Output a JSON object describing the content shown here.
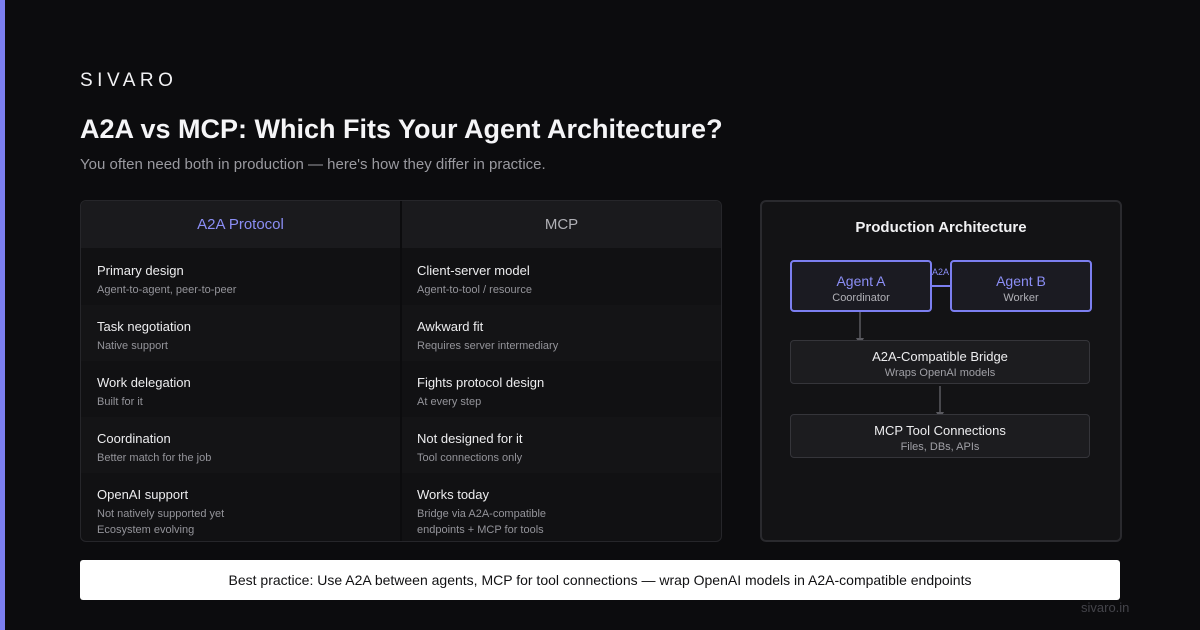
{
  "brand": "SIVARO",
  "title": "A2A vs MCP: Which Fits Your Agent Architecture?",
  "subtitle": "You often need both in production — here's how they differ in practice.",
  "comparison": {
    "left_header": "A2A Protocol",
    "right_header": "MCP",
    "rows": [
      {
        "left_title": "Primary design",
        "left_desc": "Agent-to-agent, peer-to-peer",
        "right_title": "Client-server model",
        "right_desc": "Agent-to-tool / resource"
      },
      {
        "left_title": "Task negotiation",
        "left_desc": "Native support",
        "right_title": "Awkward fit",
        "right_desc": "Requires server intermediary"
      },
      {
        "left_title": "Work delegation",
        "left_desc": "Built for it",
        "right_title": "Fights protocol design",
        "right_desc": "At every step"
      },
      {
        "left_title": "Coordination",
        "left_desc": "Better match for the job",
        "right_title": "Not designed for it",
        "right_desc": "Tool connections only"
      },
      {
        "left_title": "OpenAI support",
        "left_desc": "Not natively supported yet",
        "left_desc2": "Ecosystem evolving",
        "right_title": "Works today",
        "right_desc": "Bridge via A2A-compatible",
        "right_desc2": "endpoints + MCP for tools"
      }
    ]
  },
  "architecture": {
    "title": "Production Architecture",
    "agent_a": {
      "name": "Agent A",
      "role": "Coordinator"
    },
    "agent_b": {
      "name": "Agent B",
      "role": "Worker"
    },
    "link_label": "A2A",
    "bridge": {
      "name": "A2A-Compatible Bridge",
      "desc": "Wraps OpenAI models"
    },
    "tools": {
      "name": "MCP Tool Connections",
      "desc": "Files, DBs, APIs"
    },
    "colors": {
      "accent": "#7c7ff0",
      "connector": "#5a5a60"
    }
  },
  "banner": "Best practice: Use A2A between agents, MCP for tool connections — wrap OpenAI models in A2A-compatible endpoints",
  "footer": "sivaro.in"
}
